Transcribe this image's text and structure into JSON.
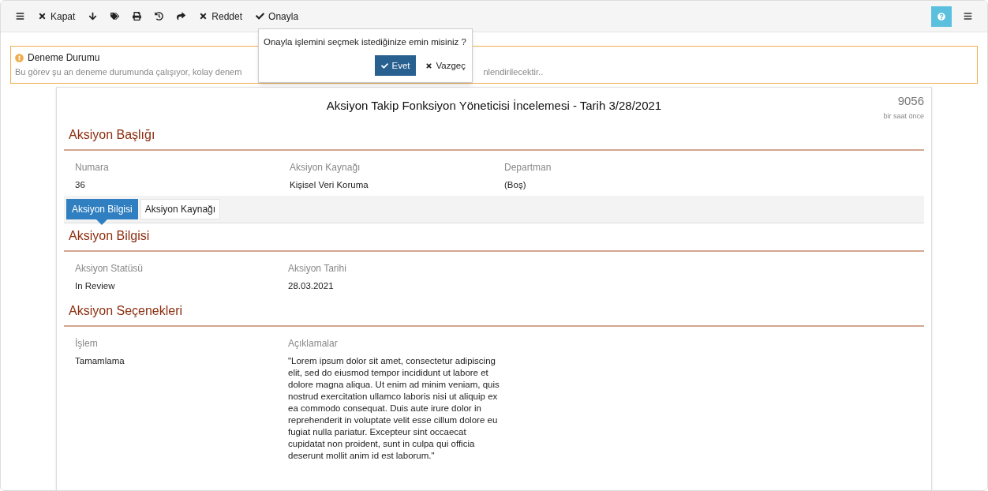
{
  "toolbar": {
    "buttons": [
      {
        "kind": "icon"
      },
      {
        "kind": "labeled",
        "label": "Kapat"
      },
      {
        "kind": "icon"
      },
      {
        "kind": "icon"
      },
      {
        "kind": "icon"
      },
      {
        "kind": "icon"
      },
      {
        "kind": "icon"
      },
      {
        "kind": "labeled",
        "label": "Reddet"
      },
      {
        "kind": "labeled",
        "label": "Onayla"
      }
    ]
  },
  "confirm_popover": {
    "message": "Onayla işlemini seçmek istediğinize emin misiniz ?",
    "confirm": "Evet",
    "cancel": "Vazgeç"
  },
  "alert": {
    "title": "Deneme Durumu",
    "text_left": "Bu görev şu an deneme durumunda çalışıyor, kolay denem",
    "text_right": "nlendirilecektir.."
  },
  "document": {
    "title": "Aksiyon Takip Fonksiyon Yöneticisi İncelemesi - Tarih 3/28/2021",
    "number": "9056",
    "time": "bir saat önce",
    "header_section": {
      "title": "Aksiyon Başlığı",
      "fields": [
        {
          "label": "Numara",
          "value": "36"
        },
        {
          "label": "Aksiyon Kaynağı",
          "value": "Kişisel Veri Koruma"
        },
        {
          "label": "Departman",
          "value": "(Boş)"
        }
      ]
    },
    "tabs": [
      {
        "label": "Aksiyon Bilgisi",
        "selected": true
      },
      {
        "label": "Aksiyon Kaynağı",
        "selected": false
      }
    ],
    "info_section": {
      "title": "Aksiyon Bilgisi",
      "fields": [
        {
          "label": "Aksiyon Statüsü",
          "value": "In Review"
        },
        {
          "label": "Aksiyon Tarihi",
          "value": "28.03.2021"
        }
      ]
    },
    "options_section": {
      "title": "Aksiyon Seçenekleri",
      "fields": [
        {
          "label": "İşlem",
          "value": "Tamamlama"
        },
        {
          "label": "Açıklamalar",
          "value": "\"Lorem ipsum dolor sit amet, consectetur adipiscing elit, sed do eiusmod tempor incididunt ut labore et dolore magna aliqua. Ut enim ad minim veniam, quis nostrud exercitation ullamco laboris nisi ut aliquip ex ea commodo consequat. Duis aute irure dolor in reprehenderit in voluptate velit esse cillum dolore eu fugiat nulla pariatur. Excepteur sint occaecat cupidatat non proident, sunt in culpa qui officia deserunt mollit anim id est laborum.\""
        }
      ]
    }
  }
}
